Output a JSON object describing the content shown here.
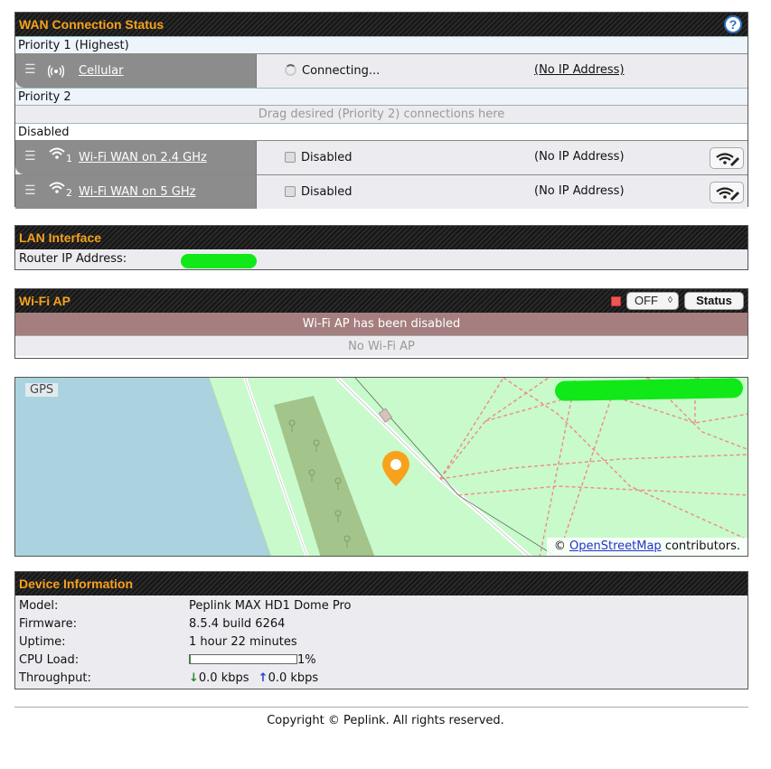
{
  "wan": {
    "title": "WAN Connection Status",
    "help_icon": "question-icon",
    "priority1_label": "Priority 1 (Highest)",
    "priority2_label": "Priority 2",
    "disabled_label": "Disabled",
    "drag_hint": "Drag desired (Priority 2) connections here",
    "connections": [
      {
        "name": "Cellular",
        "icon": "cellular-icon",
        "status": "Connecting...",
        "ip": "(No IP Address)"
      },
      {
        "num": "1",
        "name": "Wi-Fi WAN on 2.4 GHz",
        "icon": "wifi-icon",
        "status": "Disabled",
        "ip": "(No IP Address)"
      },
      {
        "num": "2",
        "name": "Wi-Fi WAN on 5 GHz",
        "icon": "wifi-icon",
        "status": "Disabled",
        "ip": "(No IP Address)"
      }
    ]
  },
  "lan": {
    "title": "LAN Interface",
    "router_ip_label": "Router IP Address:"
  },
  "wifi_ap": {
    "title": "Wi-Fi AP",
    "toggle_value": "OFF",
    "status_button": "Status",
    "disabled_banner": "Wi-Fi AP has been disabled",
    "empty_text": "No Wi-Fi AP"
  },
  "gps": {
    "label": "GPS",
    "attribution_prefix": "©",
    "attribution_link": "OpenStreetMap",
    "attribution_suffix": "contributors."
  },
  "device": {
    "title": "Device Information",
    "model_label": "Model:",
    "model": "Peplink MAX HD1 Dome Pro",
    "firmware_label": "Firmware:",
    "firmware": "8.5.4 build 6264",
    "uptime_label": "Uptime:",
    "uptime": "1 hour 22 minutes",
    "cpu_label": "CPU Load:",
    "cpu_value": "1%",
    "cpu_fraction": 0.01,
    "throughput_label": "Throughput:",
    "down": "0.0 kbps",
    "up": "0.0 kbps"
  },
  "footer": "Copyright © Peplink. All rights reserved.",
  "colors": {
    "header_text": "#f7a21c",
    "handle": "#8c8c8c",
    "disabled_banner": "#a57f7f",
    "map_water": "#aad3df",
    "map_land": "#c8facc"
  }
}
